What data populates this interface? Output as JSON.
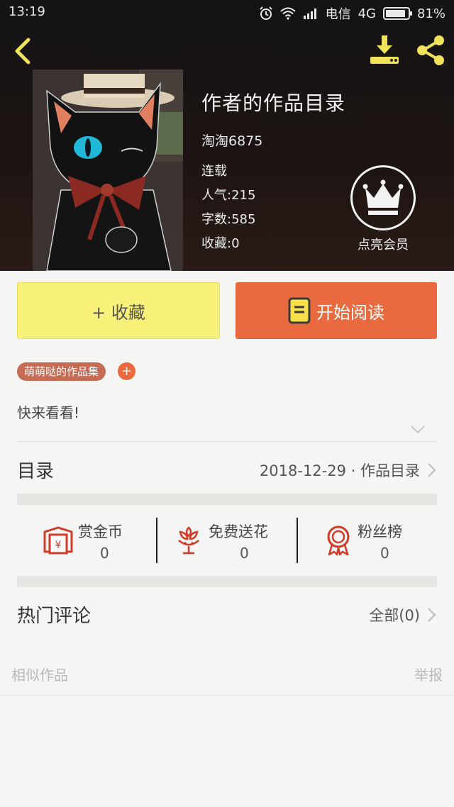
{
  "status_bar": {
    "time": "13:19",
    "carrier": "电信",
    "network": "4G",
    "battery": "81%"
  },
  "header": {
    "back_icon": "chevron-left-icon",
    "download_icon": "download-icon",
    "share_icon": "share-icon",
    "accent_color": "#f0e25a"
  },
  "book": {
    "title": "作者的作品目录",
    "author": "淘淘6875",
    "status": "连载",
    "popularity_label": "人气:",
    "popularity": "215",
    "word_count_label": "字数:",
    "word_count": "585",
    "favorites_label": "收藏:",
    "favorites": "0"
  },
  "vip": {
    "icon": "crown-icon",
    "label": "点亮会员"
  },
  "actions": {
    "collect_label": "+ 收藏",
    "collect_color": "#f8f17a",
    "read_label": "开始阅读",
    "read_color": "#e96a3e"
  },
  "tags": {
    "tag": "萌萌哒的作品集",
    "add_label": "+"
  },
  "description": "快来看看!",
  "catalog": {
    "title": "目录",
    "info": "2018-12-29 · 作品目录"
  },
  "stats": {
    "reward": {
      "label": "赏金币",
      "count": "0",
      "icon": "red-envelope-icon"
    },
    "flower": {
      "label": "免费送花",
      "count": "0",
      "icon": "flower-icon"
    },
    "fans": {
      "label": "粉丝榜",
      "count": "0",
      "icon": "medal-icon"
    }
  },
  "comments": {
    "title": "热门评论",
    "all": "全部(0)"
  },
  "footer": {
    "similar": "相似作品",
    "report": "举报"
  }
}
